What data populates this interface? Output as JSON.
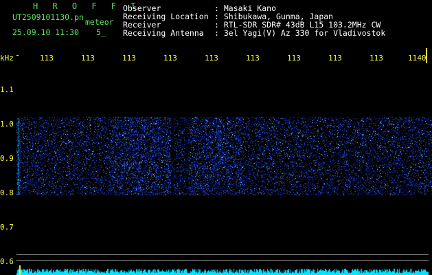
{
  "header": {
    "app_title": "H R O F F T",
    "file_label": "UT2509101130.pn",
    "mode_label": "meteor",
    "datetime": "25.09.10 11:30",
    "count": "5_",
    "info_labels": [
      "Observer",
      "Receiving Location",
      "Receiver",
      "Receiving Antenna"
    ],
    "info_values": [
      ": Masaki Kano",
      ": Shibukawa, Gunma, Japan",
      ": RTL-SDR SDR# 43dB L15 103.2MHz CW",
      ": 3el Yagi(V) Az 330 for Vladivostok"
    ]
  },
  "freq_axis": {
    "unit": "kHz",
    "ticks": [
      "113",
      "113",
      "113",
      "113",
      "113",
      "113",
      "113",
      "113",
      "113",
      "1140"
    ]
  },
  "y_axis": {
    "ticks": [
      "1.1",
      "1.0",
      "0.9",
      "0.8",
      "0.7",
      "0.6"
    ]
  },
  "colors": {
    "background": "#000000",
    "header_green": "#5ce65c",
    "tick_yellow": "#ffff3a",
    "signal_blue": "#1e46ff",
    "signal_cyan": "#00e5ff"
  }
}
